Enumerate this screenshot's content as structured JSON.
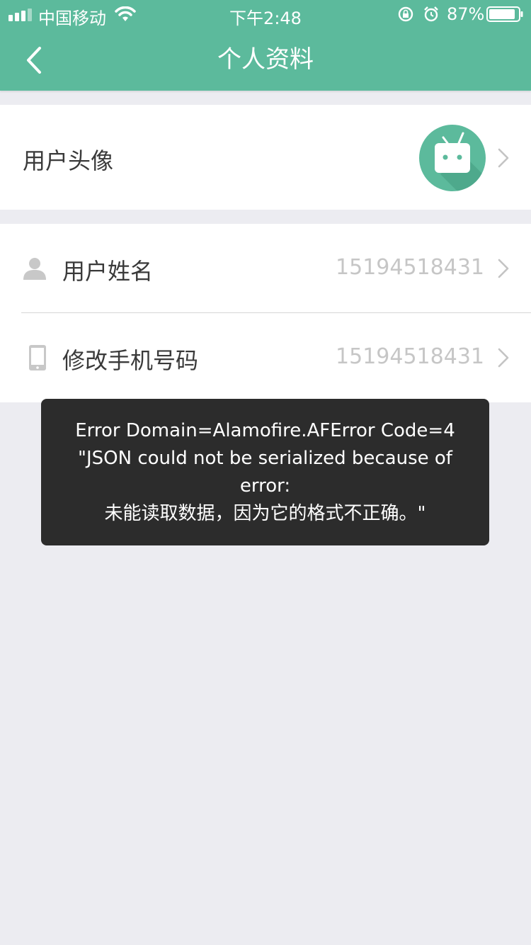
{
  "status_bar": {
    "carrier": "中国移动",
    "time": "下午2:48",
    "battery_pct": "87%"
  },
  "nav": {
    "title": "个人资料",
    "back_icon": "chevron-left-icon"
  },
  "avatar_row": {
    "label": "用户头像",
    "avatar_icon": "tv-mascot-icon"
  },
  "info_rows": [
    {
      "label": "用户姓名",
      "value": "15194518431",
      "icon": "user-icon"
    },
    {
      "label": "修改手机号码",
      "value": "15194518431",
      "icon": "phone-icon"
    }
  ],
  "toast": {
    "lines": [
      "Error Domain=Alamofire.AFError Code=4",
      "\"JSON could not be serialized because of",
      "error:",
      "未能读取数据，因为它的格式不正确。\""
    ]
  },
  "colors": {
    "accent": "#5cba9c",
    "background": "#ececf1",
    "toast_bg": "#2c2c2c"
  }
}
